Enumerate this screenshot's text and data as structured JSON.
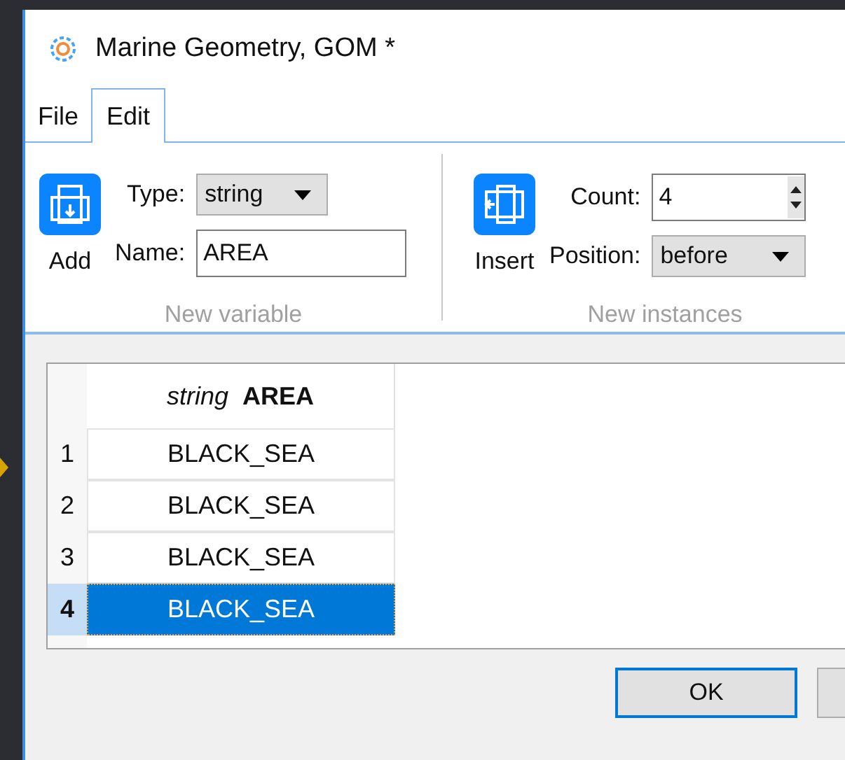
{
  "window": {
    "title": "Marine Geometry, GOM *"
  },
  "tabs": [
    {
      "label": "File",
      "selected": false
    },
    {
      "label": "Edit",
      "selected": true
    }
  ],
  "new_variable": {
    "button": "Add",
    "type_label": "Type:",
    "type_value": "string",
    "name_label": "Name:",
    "name_value": "AREA",
    "group_label": "New variable"
  },
  "new_instances": {
    "button": "Insert",
    "count_label": "Count:",
    "count_value": "4",
    "position_label": "Position:",
    "position_value": "before",
    "group_label": "New instances"
  },
  "table": {
    "column": {
      "type": "string",
      "name": "AREA"
    },
    "rows": [
      {
        "number": "1",
        "value": "BLACK_SEA",
        "selected": false
      },
      {
        "number": "2",
        "value": "BLACK_SEA",
        "selected": false
      },
      {
        "number": "3",
        "value": "BLACK_SEA",
        "selected": false
      },
      {
        "number": "4",
        "value": "BLACK_SEA",
        "selected": true
      }
    ]
  },
  "buttons": [
    "OK"
  ]
}
